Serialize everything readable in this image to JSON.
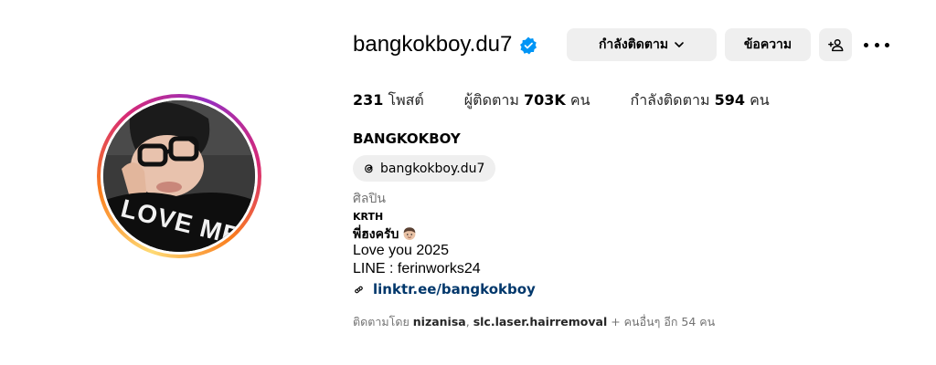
{
  "profile": {
    "username": "bangkokboy.du7",
    "verified": true,
    "full_name": "BANGKOKBOY",
    "threads_handle": "bangkokboy.du7",
    "category": "ศิลปิน",
    "avatar_shirt_text": "LOVE ME"
  },
  "buttons": {
    "following_label": "กำลังติดตาม",
    "message_label": "ข้อความ"
  },
  "stats": {
    "posts_count": "231",
    "posts_label": "โพสต์",
    "followers_label": "ผู้ติดตาม",
    "followers_count": "703K",
    "followers_unit": "คน",
    "following_label": "กำลังติดตาม",
    "following_count": "594",
    "following_unit": "คน"
  },
  "bio": {
    "tag": "KRTH",
    "line1": "พี่ฮงครับ",
    "line2": "Love you 2025",
    "line3": "LINE : ferinworks24",
    "link": "linktr.ee/bangkokboy"
  },
  "followed_by": {
    "prefix": "ติดตามโดย",
    "user1": "nizanisa",
    "separator": ",",
    "user2": "slc.laser.hairremoval",
    "suffix": "+ คนอื่นๆ อีก 54 คน"
  },
  "colors": {
    "verified_blue": "#0095f6",
    "link_blue": "#00376b",
    "button_bg": "#efefef",
    "muted_text": "#737373"
  },
  "icons": [
    "verified-badge-icon",
    "chevron-down-icon",
    "add-person-icon",
    "more-options-icon",
    "threads-icon",
    "link-icon"
  ]
}
